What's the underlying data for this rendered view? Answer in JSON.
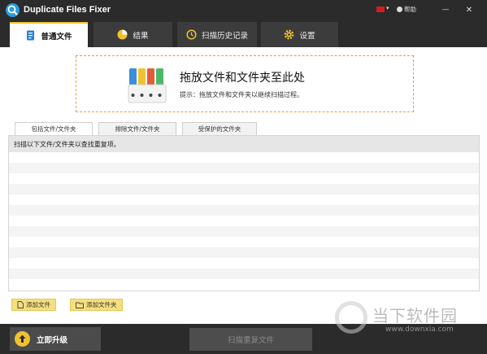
{
  "app": {
    "title": "Duplicate Files Fixer"
  },
  "titlebar": {
    "help_label": "帮助",
    "flag_caret": "▾",
    "minimize": "—",
    "close": "✕"
  },
  "tabs": [
    {
      "label": "普通文件",
      "icon": "document-icon"
    },
    {
      "label": "结果",
      "icon": "pie-chart-icon"
    },
    {
      "label": "扫描历史记录",
      "icon": "history-icon"
    },
    {
      "label": "设置",
      "icon": "gear-icon"
    }
  ],
  "dropzone": {
    "title": "拖放文件和文件夹至此处",
    "hint": "提示：拖放文件和文件夹以继续扫描过程。"
  },
  "subtabs": [
    {
      "label": "包括文件/文件夹"
    },
    {
      "label": "排除文件/文件夹"
    },
    {
      "label": "受保护的文件夹"
    }
  ],
  "list": {
    "header": "扫描以下文件/文件夹以查找重复项。"
  },
  "buttons": {
    "add_file": "添加文件",
    "add_folder": "添加文件夹",
    "upgrade": "立即升级",
    "scan": "扫描重复文件"
  },
  "watermark": {
    "text": "当下软件园",
    "url": "www.downxia.com"
  },
  "colors": {
    "accent": "#f0c231",
    "dark": "#2b2b2b",
    "drop_border": "#e79a4a"
  }
}
